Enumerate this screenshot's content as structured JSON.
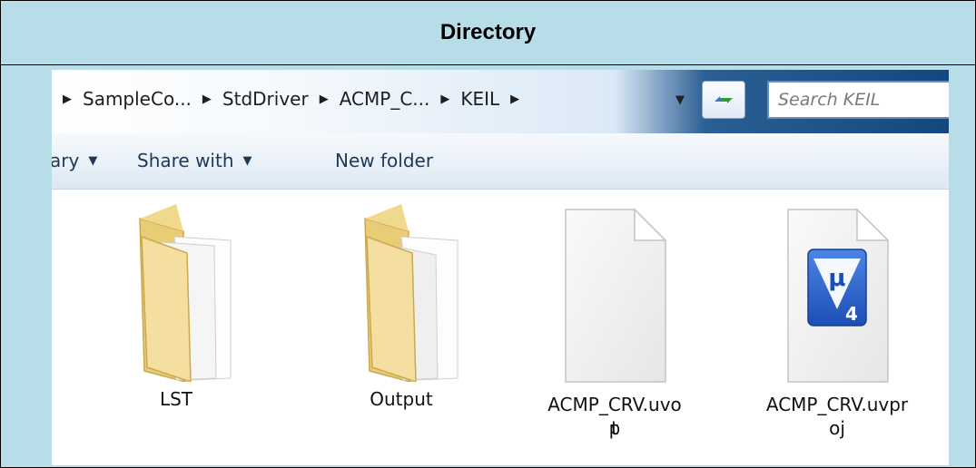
{
  "title": "Directory",
  "explorer": {
    "breadcrumb": [
      "SampleCo...",
      "StdDriver",
      "ACMP_C...",
      "KEIL"
    ],
    "search_placeholder": "Search KEIL",
    "toolbar": {
      "library_label": "ary",
      "share_label": "Share with",
      "new_folder_label": "New folder"
    },
    "files": [
      {
        "name_line1": "LST",
        "name_line2": "",
        "icon": "folder-icon"
      },
      {
        "name_line1": "Output",
        "name_line2": "",
        "icon": "folder-icon"
      },
      {
        "name_line1": "ACMP_CRV.uvop",
        "name_line2": "t",
        "icon": "blank-file-icon"
      },
      {
        "name_line1": "ACMP_CRV.uvpr",
        "name_line2": "oj",
        "icon": "keil-uvision-icon"
      }
    ]
  },
  "colors": {
    "table_background": "#b7dde8",
    "content_background": "#ffffff",
    "keil_icon_blue": "#2a5fc9"
  }
}
